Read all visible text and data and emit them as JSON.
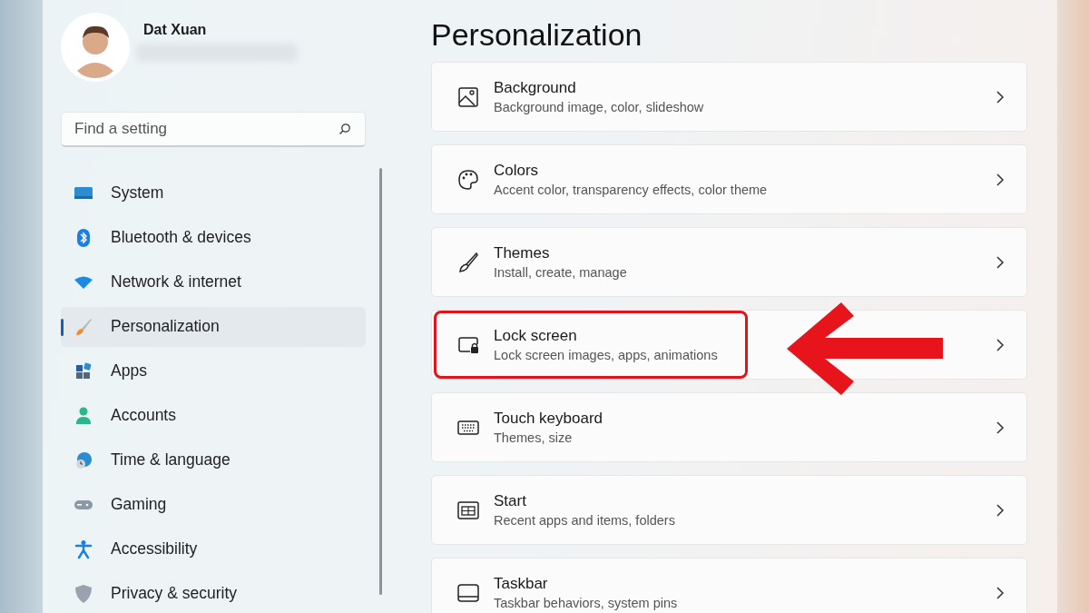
{
  "user": {
    "name": "Dat Xuan"
  },
  "search": {
    "placeholder": "Find a setting"
  },
  "nav": [
    {
      "label": "System",
      "selected": false
    },
    {
      "label": "Bluetooth & devices",
      "selected": false
    },
    {
      "label": "Network & internet",
      "selected": false
    },
    {
      "label": "Personalization",
      "selected": true
    },
    {
      "label": "Apps",
      "selected": false
    },
    {
      "label": "Accounts",
      "selected": false
    },
    {
      "label": "Time & language",
      "selected": false
    },
    {
      "label": "Gaming",
      "selected": false
    },
    {
      "label": "Accessibility",
      "selected": false
    },
    {
      "label": "Privacy & security",
      "selected": false
    }
  ],
  "page_title": "Personalization",
  "cards": [
    {
      "title": "Background",
      "subtitle": "Background image, color, slideshow",
      "highlighted": false
    },
    {
      "title": "Colors",
      "subtitle": "Accent color, transparency effects, color theme",
      "highlighted": false
    },
    {
      "title": "Themes",
      "subtitle": "Install, create, manage",
      "highlighted": false
    },
    {
      "title": "Lock screen",
      "subtitle": "Lock screen images, apps, animations",
      "highlighted": true
    },
    {
      "title": "Touch keyboard",
      "subtitle": "Themes, size",
      "highlighted": false
    },
    {
      "title": "Start",
      "subtitle": "Recent apps and items, folders",
      "highlighted": false
    },
    {
      "title": "Taskbar",
      "subtitle": "Taskbar behaviors, system pins",
      "highlighted": false
    }
  ]
}
